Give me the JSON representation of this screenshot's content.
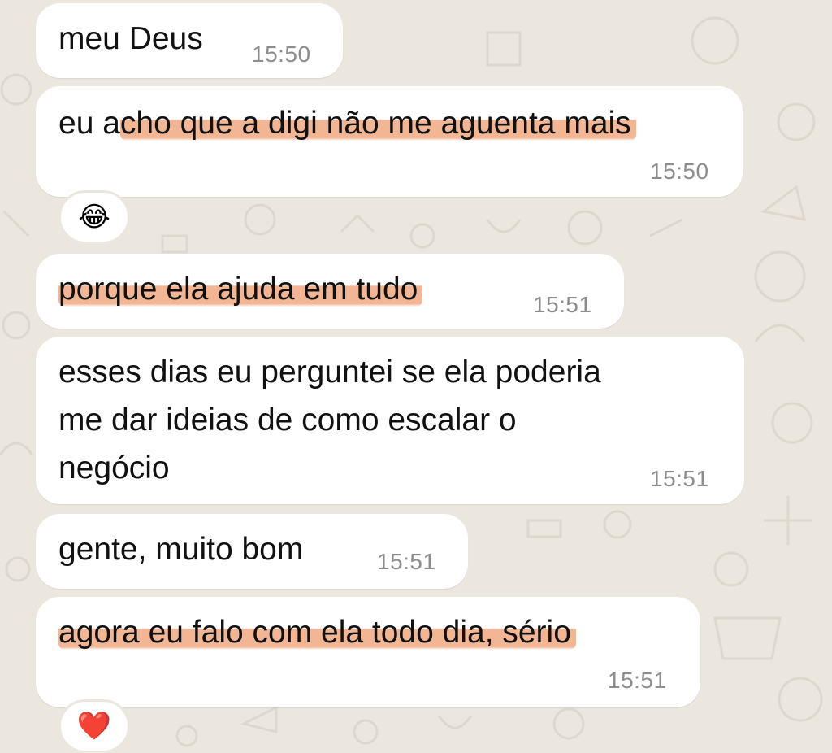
{
  "chat": {
    "messages": [
      {
        "text": "meu Deus",
        "time": "15:50"
      },
      {
        "text_plain": "eu a",
        "text_highlight": "cho que a digi não me aguenta mais",
        "time": "15:50",
        "reaction": "😂"
      },
      {
        "text_highlight": "porque ela ajuda em tudo",
        "time": "15:51"
      },
      {
        "lines": [
          "esses dias eu perguntei se ela poderia",
          "me dar ideias de como escalar o",
          "negócio"
        ],
        "time": "15:51"
      },
      {
        "text": "gente, muito bom",
        "time": "15:51"
      },
      {
        "text_highlight": "agora eu falo com ela todo dia, sério",
        "time": "15:51",
        "reaction": "❤️"
      }
    ]
  },
  "colors": {
    "background": "#ece7de",
    "bubble": "#ffffff",
    "highlight": "#f0ac85",
    "timestamp": "#8d8d8d"
  }
}
